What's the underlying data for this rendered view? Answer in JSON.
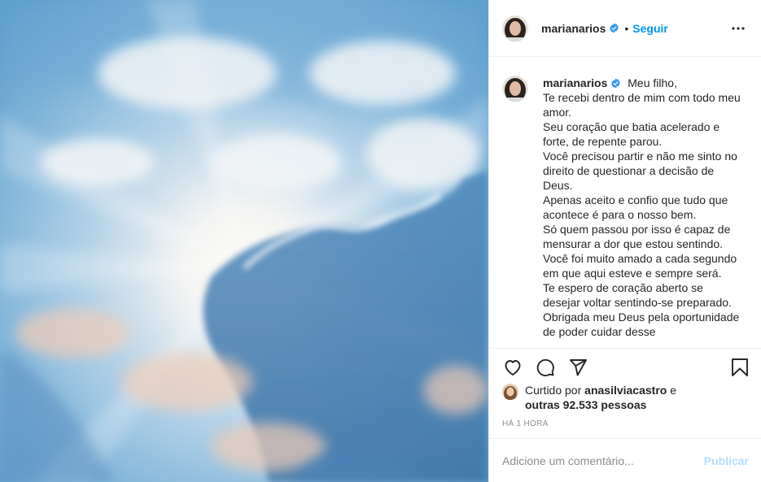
{
  "header": {
    "username": "marianarios",
    "separator": "•",
    "follow_label": "Seguir",
    "more_icon": "more-horizontal-icon"
  },
  "caption": {
    "username": "marianarios",
    "lines": [
      "Meu filho,",
      "Te recebi dentro de mim com todo meu amor.",
      "Seu coração que batia acelerado e forte, de repente parou.",
      "Você precisou partir e não me sinto no direito de questionar a decisão de Deus.",
      "Apenas aceito e confio que tudo que acontece é para o nosso bem.",
      "Só quem passou por isso é capaz de mensurar a dor que estou sentindo.",
      "Você foi muito amado a cada segundo em que aqui esteve e sempre será.",
      "Te espero de coração aberto se desejar voltar sentindo-se preparado.",
      "Obrigada meu Deus pela oportunidade de poder cuidar desse"
    ]
  },
  "actions": {
    "like_icon": "heart-icon",
    "comment_icon": "comment-icon",
    "share_icon": "share-icon",
    "save_icon": "bookmark-icon"
  },
  "likes": {
    "prefix": "Curtido por ",
    "liker": "anasilviacastro",
    "conjunction": " e",
    "others": "outras 92.533 pessoas"
  },
  "time": "HÁ 1 HORA",
  "comment_box": {
    "placeholder": "Adicione um comentário...",
    "publish_label": "Publicar"
  },
  "colors": {
    "link_blue": "#0095f6",
    "publish_disabled": "#b2dffc",
    "muted_text": "#8e8e8e",
    "sky": "#6aa3cf"
  }
}
